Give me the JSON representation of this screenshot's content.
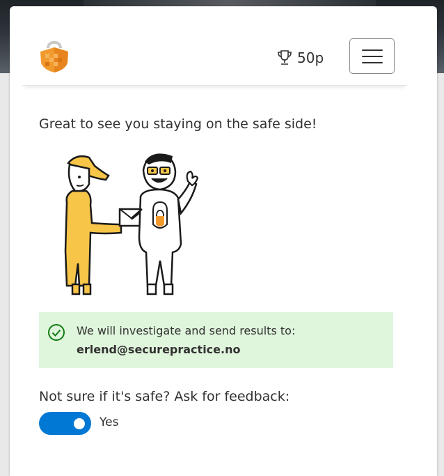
{
  "header": {
    "logo_icon": "secure-practice-shield-logo",
    "trophy_icon": "trophy-icon",
    "points": "50p",
    "menu_icon": "hamburger-menu-icon"
  },
  "main": {
    "greeting": "Great to see you staying on the safe side!",
    "illustration": "delivery-person-handing-envelope-to-smiling-user"
  },
  "notice": {
    "icon": "check-circle-icon",
    "message": "We will investigate and send results to:",
    "email": "erlend@securepractice.no",
    "background_color": "#dff6dd",
    "icon_color": "#107c10"
  },
  "feedback": {
    "question": "Not sure if it's safe? Ask for feedback:",
    "toggle_on": true,
    "toggle_label": "Yes",
    "toggle_color": "#0078d4"
  },
  "colors": {
    "brand_orange": "#f29a2e",
    "illustration_yellow": "#f7c548"
  }
}
